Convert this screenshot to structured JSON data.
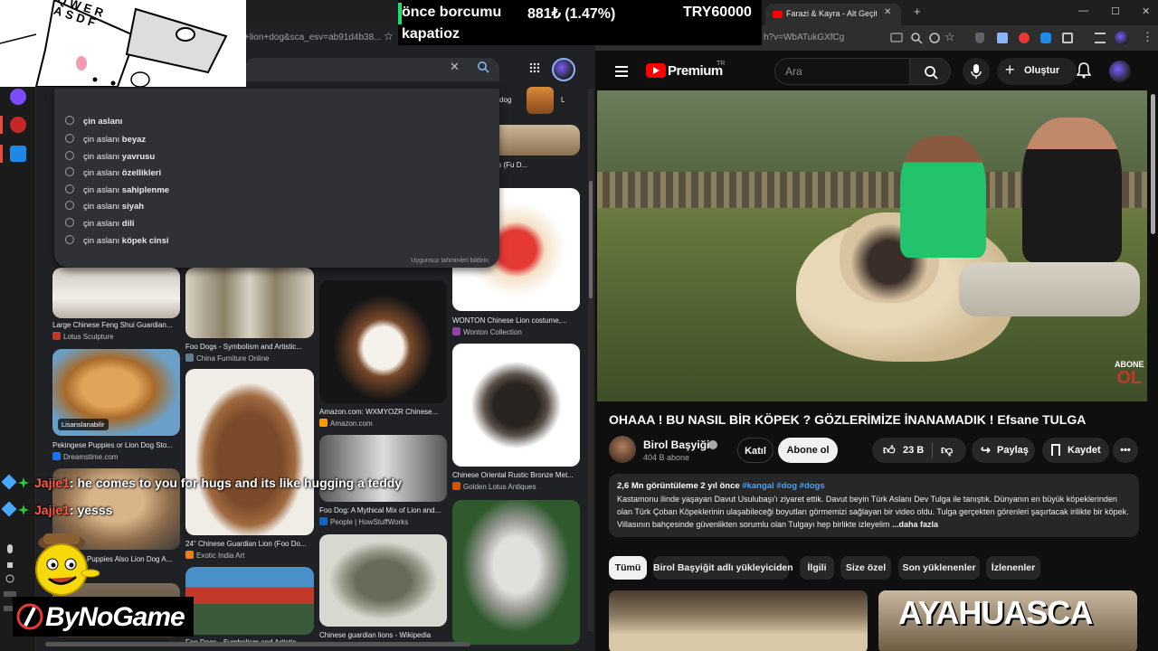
{
  "ticker": {
    "line1_left": "önce borcumu",
    "change": "881₺ (1.47%)",
    "total": "TRY60000",
    "line2": "kapatioz"
  },
  "overlay": {
    "keyboard_keys": "QWER ASDF"
  },
  "left_browser": {
    "address_text": "+lion+dog&sca_esv=ab91d4b38...",
    "search": {
      "clear_label": "✕"
    },
    "suggestions": [
      {
        "prefix": "çin aslanı",
        "suffix": "beyaz"
      },
      {
        "prefix": "çin aslanı",
        "suffix": "yavrusu"
      },
      {
        "prefix": "çin aslanı",
        "suffix": "özellikleri"
      },
      {
        "prefix": "çin aslanı",
        "suffix": "sahiplenme"
      },
      {
        "prefix": "çin aslanı",
        "suffix": "siyah"
      },
      {
        "prefix": "çin aslanı",
        "suffix": "dili"
      },
      {
        "prefix": "çin aslanı",
        "suffix": "köpek cinsi"
      }
    ],
    "suggestion_partial": "çin aslanı",
    "report_label": "Uygunsuz tahminleri bildirin",
    "top_tabs": {
      "dog": "dog",
      "l": "L"
    },
    "images": [
      {
        "caption": "Large Chinese Feng Shui Guardian...",
        "source": "Lotus Sculpture"
      },
      {
        "caption": "Foo Dogs - Symbolism and Artistic...",
        "source": "China Furniture Online"
      },
      {
        "caption": "Amazon.com: WXMYOZR Chinese...",
        "source": "Amazon.com"
      },
      {
        "caption": "WONTON Chinese Lion costume,...",
        "source": "Wonton Collection"
      },
      {
        "caption": "Guardian Lions (Fu D...",
        "source": ""
      },
      {
        "caption": "Pekingese Puppies or Lion Dog Sto...",
        "source": "Dreamstime.com",
        "badge": "Lisanslanabilir"
      },
      {
        "caption": "Chinese Oriental Rustic Bronze Met...",
        "source": "Golden Lotus Antiques"
      },
      {
        "caption": "Foo Dog: A Mythical Mix of Lion and...",
        "source": "People | HowStuffWorks"
      },
      {
        "caption": "24\" Chinese Guardian Lion (Foo Do...",
        "source": "Exotic India Art"
      },
      {
        "caption": "Puppies Also Lion Dog A...",
        "source": ""
      },
      {
        "caption": "Chinese guardian lions - Wikipedia",
        "source": ""
      },
      {
        "caption": "Foo Dogs - Symbolism and Artistic...",
        "source": ""
      }
    ]
  },
  "chat": [
    {
      "user": "Jajie1",
      "message": ": he comes to you for hugs and its like hugging a teddy"
    },
    {
      "user": "Jajie1",
      "message": ": yesss"
    }
  ],
  "logo": {
    "text": "ByNoGame"
  },
  "youtube": {
    "tab_title": "Farazi & Kayra - Alt Geçit - You",
    "url": "h?v=WbATukGXfCg",
    "brand": "Premium",
    "region": "TR",
    "search_placeholder": "Ara",
    "create_label": "Oluştur",
    "video_title": "OHAAA ! BU NASIL BİR KÖPEK ? GÖZLERİMİZE İNANAMADIK ! Efsane TULGA",
    "channel_name": "Birol Başyiğit",
    "subscribers": "404 B abone",
    "join_label": "Katıl",
    "subscribe_label": "Abone ol",
    "likes": "23 B",
    "share_label": "Paylaş",
    "save_label": "Kaydet",
    "views_date": "2,6 Mn görüntüleme  2 yıl önce",
    "tags": "#kangal #dog #dogs",
    "description": "Kastamonu ilinde yaşayan Davut Usulubaşı'ı ziyaret ettik. Davut beyin Türk Aslanı Dev Tulga ile tanıştık. Dünyanın en büyük köpeklerinden olan Türk Çoban Köpeklerinin ulaşabileceği boyutları görmemizi sağlayan bir video oldu. Tulga gerçekten görenleri şaşırtacak irilikte bir köpek. Villasının bahçesinde güvenlikten sorumlu olan Tulgayı hep birlikte izleyelim",
    "more_label": "...daha fazla",
    "video_overlay": {
      "line1": "ABONE",
      "line2": "OL"
    },
    "chips": [
      {
        "label": "Tümü",
        "active": true
      },
      {
        "label": "Birol Başyiğit adlı yükleyiciden",
        "active": false
      },
      {
        "label": "İlgili",
        "active": false
      },
      {
        "label": "Size özel",
        "active": false
      },
      {
        "label": "Son yüklenenler",
        "active": false
      },
      {
        "label": "İzlenenler",
        "active": false
      }
    ],
    "thumb2_text": "AYAHUASCA"
  }
}
